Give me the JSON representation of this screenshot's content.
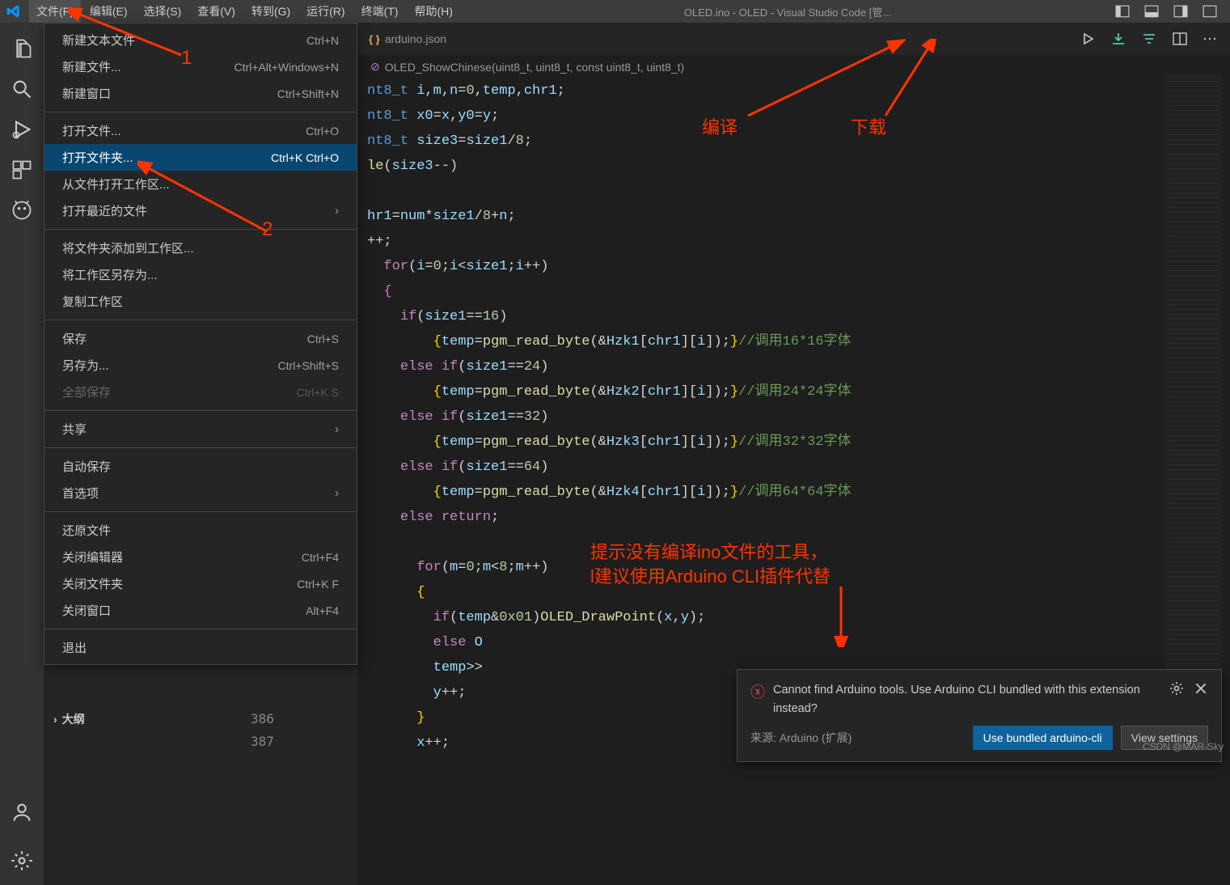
{
  "title": "OLED.ino - OLED - Visual Studio Code [管...",
  "menu": {
    "items": [
      "文件(F)",
      "编辑(E)",
      "选择(S)",
      "查看(V)",
      "转到(G)",
      "运行(R)",
      "终端(T)",
      "帮助(H)"
    ]
  },
  "file_menu": [
    {
      "label": "新建文本文件",
      "shortcut": "Ctrl+N"
    },
    {
      "label": "新建文件...",
      "shortcut": "Ctrl+Alt+Windows+N"
    },
    {
      "label": "新建窗口",
      "shortcut": "Ctrl+Shift+N"
    },
    {
      "sep": true
    },
    {
      "label": "打开文件...",
      "shortcut": "Ctrl+O"
    },
    {
      "label": "打开文件夹...",
      "shortcut": "Ctrl+K Ctrl+O",
      "hl": true
    },
    {
      "label": "从文件打开工作区..."
    },
    {
      "label": "打开最近的文件",
      "sub": true
    },
    {
      "sep": true
    },
    {
      "label": "将文件夹添加到工作区..."
    },
    {
      "label": "将工作区另存为..."
    },
    {
      "label": "复制工作区"
    },
    {
      "sep": true
    },
    {
      "label": "保存",
      "shortcut": "Ctrl+S"
    },
    {
      "label": "另存为...",
      "shortcut": "Ctrl+Shift+S"
    },
    {
      "label": "全部保存",
      "shortcut": "Ctrl+K S",
      "disabled": true
    },
    {
      "sep": true
    },
    {
      "label": "共享",
      "sub": true
    },
    {
      "sep": true
    },
    {
      "label": "自动保存"
    },
    {
      "label": "首选项",
      "sub": true
    },
    {
      "sep": true
    },
    {
      "label": "还原文件"
    },
    {
      "label": "关闭编辑器",
      "shortcut": "Ctrl+F4"
    },
    {
      "label": "关闭文件夹",
      "shortcut": "Ctrl+K F"
    },
    {
      "label": "关闭窗口",
      "shortcut": "Alt+F4"
    },
    {
      "sep": true
    },
    {
      "label": "退出"
    }
  ],
  "tab": {
    "label": "arduino.json"
  },
  "breadcrumb": "OLED_ShowChinese(uint8_t, uint8_t, const uint8_t, uint8_t)",
  "code": [
    "nt8_t i,m,n=0,temp,chr1;",
    "nt8_t x0=x,y0=y;",
    "nt8_t size3=size1/8;",
    "le(size3--)",
    "",
    "hr1=num*size1/8+n;",
    "++;",
    "for(i=0;i<size1;i++)",
    "{",
    "  if(size1==16)",
    "      {temp=pgm_read_byte(&Hzk1[chr1][i]);}//调用16*16字体",
    "  else if(size1==24)",
    "      {temp=pgm_read_byte(&Hzk2[chr1][i]);}//调用24*24字体",
    "  else if(size1==32)",
    "      {temp=pgm_read_byte(&Hzk3[chr1][i]);}//调用32*32字体",
    "  else if(size1==64)",
    "      {temp=pgm_read_byte(&Hzk4[chr1][i]);}//调用64*64字体",
    "  else return;",
    "",
    "    for(m=0;m<8;m++)",
    "    {",
    "      if(temp&0x01)OLED_DrawPoint(x,y);",
    "      else O",
    "      temp>>",
    "      y++;",
    "    }",
    "    x++;"
  ],
  "outline": {
    "title": "大纲",
    "lines": [
      "386",
      "387"
    ]
  },
  "notif": {
    "message": "Cannot find Arduino tools. Use Arduino CLI bundled with this extension instead?",
    "source": "来源: Arduino (扩展)",
    "btn_primary": "Use bundled arduino-cli",
    "btn_secondary": "View settings"
  },
  "annotations": {
    "n1": "1",
    "n2": "2",
    "compile": "编译",
    "download": "下载",
    "tip1": "提示没有编译ino文件的工具，",
    "tip2": "l建议使用Arduino CLI插件代替"
  },
  "watermark": "CSDN @MAR-Sky"
}
